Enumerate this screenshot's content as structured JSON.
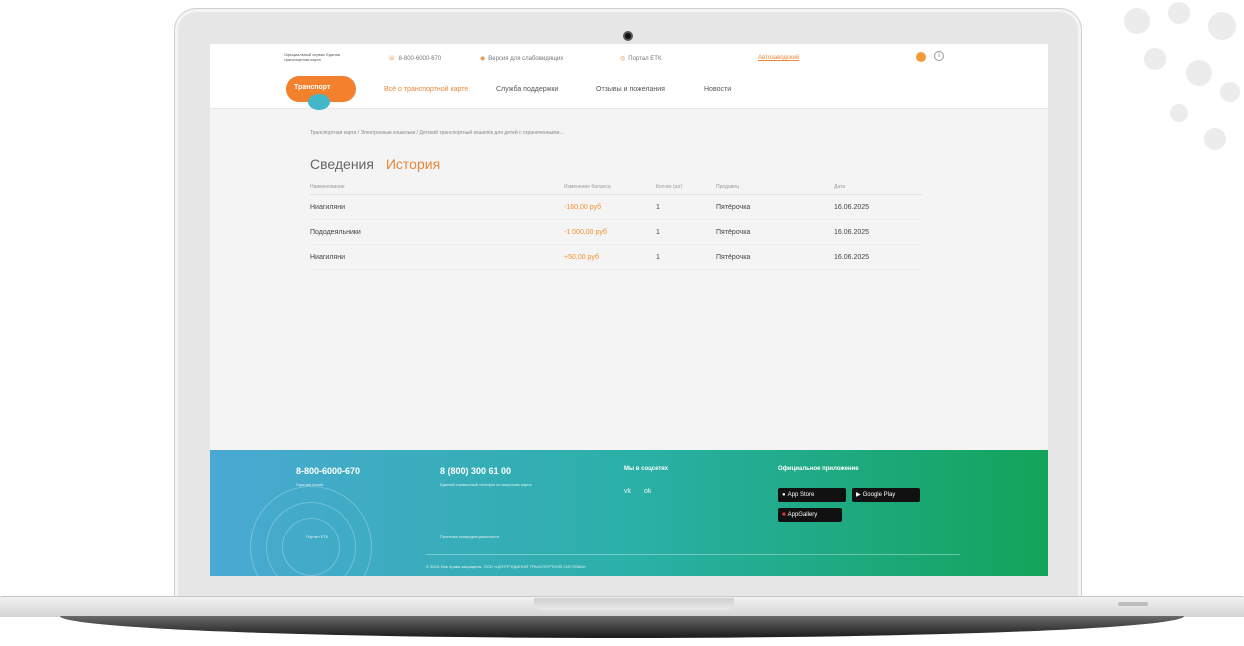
{
  "header": {
    "brand_note": "Официальный сервис Единая транспортная карта",
    "phone_link": "8-800-6000-670",
    "version_link": "Версия для слабовидящих",
    "portal_link": "Портал ЕТК",
    "city": "Автозаводский"
  },
  "logo": {
    "text": "Транспорт"
  },
  "nav": [
    {
      "label": "Всё о транспортной карте",
      "active": true
    },
    {
      "label": "Служба поддержки",
      "active": false
    },
    {
      "label": "Отзывы и пожелания",
      "active": false
    },
    {
      "label": "Новости",
      "active": false
    }
  ],
  "breadcrumb": "Транспортная карта / Электронные кошельки / Детский транспортный кошелёк для детей с ограниченными...",
  "tabs": {
    "info": "Сведения",
    "history": "История"
  },
  "table": {
    "headers": [
      "Наименование",
      "Изменение баланса",
      "Кол-во (шт)",
      "Продавец",
      "Дата"
    ],
    "rows": [
      {
        "name": "Ниагиляни",
        "amount": "-160,00 руб",
        "qty": "1",
        "seller": "Пятёрочка",
        "date": "16.06.2025"
      },
      {
        "name": "Пододеяльники",
        "amount": "-1 000,00 руб",
        "qty": "1",
        "seller": "Пятёрочка",
        "date": "16.06.2025"
      },
      {
        "name": "Ниагиляни",
        "amount": "+50,00 руб",
        "qty": "1",
        "seller": "Пятёрочка",
        "date": "16.06.2025"
      }
    ]
  },
  "footer": {
    "phone1": "8-800-6000-670",
    "phone1_note": "Горячая линия",
    "phone2": "8 (800) 300 61 00",
    "phone2_note": "Единый справочный телефон по вопросам карты",
    "social_title": "Мы в соцсетях",
    "social_icons": [
      "vk",
      "ok"
    ],
    "apps_title": "Официальное приложение",
    "app_store": "App Store",
    "google_play": "Google Play",
    "app_gallery": "AppGallery",
    "portal_link": "Портал ЕТК",
    "privacy_link": "Политика конфиденциальности",
    "copyright": "© 2025. Все права защищены. ООО «ЦЕНТР ЕДИНОЙ ТРАНСПОРТНОЙ СИСТЕМЫ»"
  },
  "colors": {
    "accent": "#e8873a",
    "footer_start": "#4aa9d3",
    "footer_end": "#14a35a"
  }
}
